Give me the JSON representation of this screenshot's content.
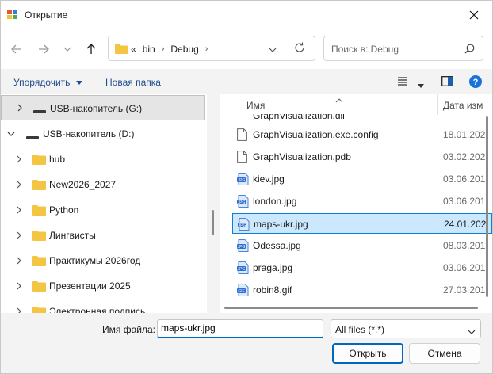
{
  "window": {
    "title": "Открытие"
  },
  "address": {
    "crumbs": [
      "«",
      "bin",
      "Debug"
    ]
  },
  "search": {
    "placeholder": "Поиск в: Debug"
  },
  "toolbar": {
    "organize_label": "Упорядочить",
    "new_folder_label": "Новая папка"
  },
  "tree": {
    "items": [
      {
        "label": "USB-накопитель (G:)",
        "type": "drive",
        "expanded": false,
        "selected": true
      },
      {
        "label": "USB-накопитель (D:)",
        "type": "drive",
        "expanded": true,
        "selected": false
      },
      {
        "label": "hub",
        "type": "folder"
      },
      {
        "label": "New2026_2027",
        "type": "folder"
      },
      {
        "label": "Python",
        "type": "folder"
      },
      {
        "label": "Лингвисты",
        "type": "folder"
      },
      {
        "label": "Практикумы 2026год",
        "type": "folder"
      },
      {
        "label": "Презентации 2025",
        "type": "folder"
      },
      {
        "label": "Электронная подпись",
        "type": "folder"
      }
    ]
  },
  "files": {
    "columns": {
      "name": "Имя",
      "date": "Дата изм"
    },
    "partial_row": "GraphVisualization.dll",
    "rows": [
      {
        "name": "GraphVisualization.exe.config",
        "date": "18.01.202",
        "icon": "doc",
        "selected": false
      },
      {
        "name": "GraphVisualization.pdb",
        "date": "03.02.202",
        "icon": "doc",
        "selected": false
      },
      {
        "name": "kiev.jpg",
        "date": "03.06.201",
        "icon": "jpg",
        "selected": false
      },
      {
        "name": "london.jpg",
        "date": "03.06.201",
        "icon": "jpg",
        "selected": false
      },
      {
        "name": "maps-ukr.jpg",
        "date": "24.01.202",
        "icon": "jpg",
        "selected": true
      },
      {
        "name": "Odessa.jpg",
        "date": "08.03.201",
        "icon": "jpg",
        "selected": false
      },
      {
        "name": "praga.jpg",
        "date": "03.06.201",
        "icon": "jpg",
        "selected": false
      },
      {
        "name": "robin8.gif",
        "date": "27.03.201",
        "icon": "gif",
        "selected": false
      }
    ]
  },
  "bottom": {
    "filename_label": "Имя файла:",
    "filename_value": "maps-ukr.jpg",
    "filter_value": "All files (*.*)",
    "open_label": "Открыть",
    "cancel_label": "Отмена"
  },
  "colors": {
    "accent": "#0067c0",
    "selection_bg": "#cce8ff",
    "folder": "#f4c542",
    "link": "#1e4e8c"
  }
}
